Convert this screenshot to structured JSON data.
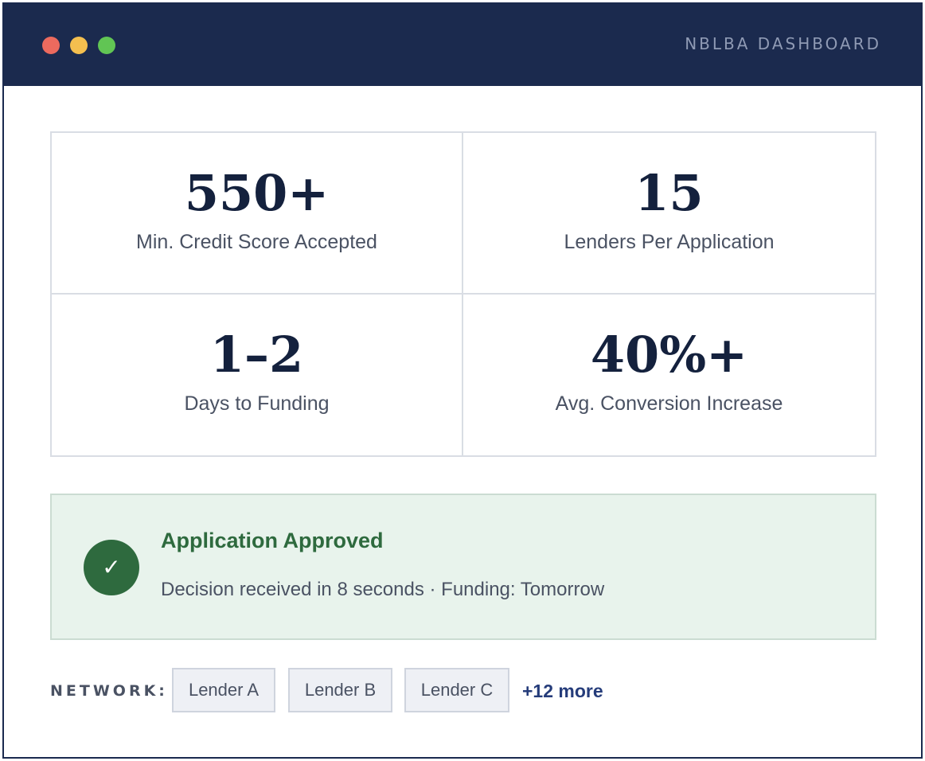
{
  "window": {
    "title": "NBLBA DASHBOARD",
    "controls": {
      "close_color": "#ec6a5e",
      "minimize_color": "#f4bf4f",
      "maximize_color": "#61c554"
    }
  },
  "stats": [
    {
      "value": "550+",
      "label": "Min. Credit Score Accepted"
    },
    {
      "value": "15",
      "label": "Lenders Per Application"
    },
    {
      "value": "1–2",
      "label": "Days to Funding"
    },
    {
      "value": "40%+",
      "label": "Avg. Conversion Increase"
    }
  ],
  "approval": {
    "icon": "check-icon",
    "icon_glyph": "✓",
    "title": "Application Approved",
    "detail": "Decision received in 8 seconds · Funding: Tomorrow",
    "accent_color": "#2e6a3e"
  },
  "network": {
    "label": "NETWORK:",
    "lenders": [
      "Lender A",
      "Lender B",
      "Lender C"
    ],
    "more_label": "+12 more"
  },
  "colors": {
    "brand_navy": "#1b2a4e",
    "success_green": "#2e6a3e",
    "link_blue": "#253c7a"
  }
}
